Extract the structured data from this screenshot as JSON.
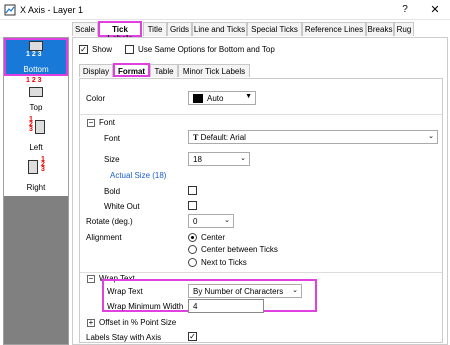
{
  "window": {
    "title": "X Axis - Layer 1",
    "help": "?",
    "close": "✕"
  },
  "sidebar": {
    "items": [
      {
        "label": "Bottom",
        "digits": "1 2 3"
      },
      {
        "label": "Top",
        "digits": "1 2 3"
      },
      {
        "label": "Left",
        "digits": "1 2 3"
      },
      {
        "label": "Right",
        "digits": "1 2 3"
      }
    ]
  },
  "tabs": [
    "Scale",
    "Tick Labels",
    "Title",
    "Grids",
    "Line and Ticks",
    "Special Ticks",
    "Reference Lines",
    "Breaks",
    "Rug"
  ],
  "show": {
    "label": "Show",
    "checked": true
  },
  "same_options": {
    "label": "Use Same Options for Bottom and Top"
  },
  "subtabs": [
    "Display",
    "Format",
    "Table",
    "Minor Tick Labels"
  ],
  "color": {
    "label": "Color",
    "value": "Auto"
  },
  "font_section": {
    "label": "Font"
  },
  "font": {
    "label": "Font",
    "value": "Default: Arial",
    "icon_text": "T"
  },
  "size": {
    "label": "Size",
    "value": "18"
  },
  "actual_size": {
    "label": "Actual Size (18)"
  },
  "bold": {
    "label": "Bold"
  },
  "white_out": {
    "label": "White Out"
  },
  "rotate": {
    "label": "Rotate (deg.)",
    "value": "0"
  },
  "alignment": {
    "label": "Alignment",
    "options": [
      "Center",
      "Center between Ticks",
      "Next to Ticks"
    ],
    "selected": 0
  },
  "wrap_section": {
    "label": "Wrap Text"
  },
  "wrap_text": {
    "label": "Wrap Text",
    "value": "By Number of Characters"
  },
  "wrap_min_width": {
    "label": "Wrap Minimum Width",
    "value": "4"
  },
  "offset": {
    "label": "Offset in % Point Size"
  },
  "labels_stay": {
    "label": "Labels Stay with Axis",
    "checked": true
  },
  "colors": {
    "accent_select": "#1879d8",
    "highlight": "#e040e0",
    "link": "#1a5fd0"
  }
}
